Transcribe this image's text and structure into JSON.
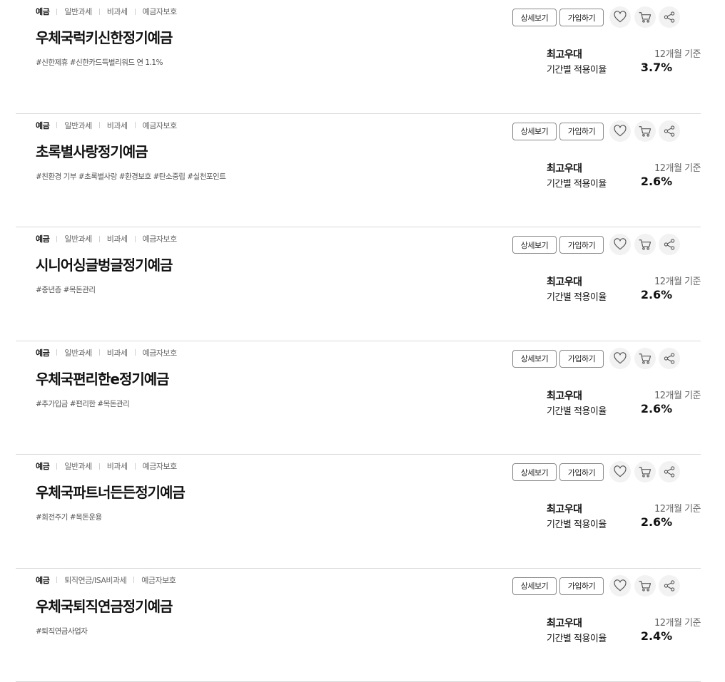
{
  "buttons": {
    "detail": "상세보기",
    "join": "가입하기"
  },
  "icons": {
    "favorite": "heart-icon",
    "cart": "cart-icon",
    "share": "share-icon"
  },
  "products": [
    {
      "cats": [
        "예금",
        "일반과세",
        "비과세",
        "예금자보호"
      ],
      "title": "우체국럭키신한정기예금",
      "tags": "#신한제휴 #신한카드득별리워드 연 1.1%",
      "rate_label1": "최고우대",
      "rate_label2": "기간별 적용이율",
      "basis": "12개월 기준",
      "rate": "3.7%"
    },
    {
      "cats": [
        "예금",
        "일반과세",
        "비과세",
        "예금자보호"
      ],
      "title": "초록별사랑정기예금",
      "tags": "#친환경 기부 #초록별사랑 #환경보호 #탄소중립 #실천포인트",
      "rate_label1": "최고우대",
      "rate_label2": "기간별 적용이율",
      "basis": "12개월 기준",
      "rate": "2.6%"
    },
    {
      "cats": [
        "예금",
        "일반과세",
        "비과세",
        "예금자보호"
      ],
      "title": "시니어싱글벙글정기예금",
      "tags": "#중년층 #목돈관리",
      "rate_label1": "최고우대",
      "rate_label2": "기간별 적용이율",
      "basis": "12개월 기준",
      "rate": "2.6%"
    },
    {
      "cats": [
        "예금",
        "일반과세",
        "비과세",
        "예금자보호"
      ],
      "title": "우체국편리한e정기예금",
      "tags": "#추가입금 #편리한 #목돈관리",
      "rate_label1": "최고우대",
      "rate_label2": "기간별 적용이율",
      "basis": "12개월 기준",
      "rate": "2.6%"
    },
    {
      "cats": [
        "예금",
        "일반과세",
        "비과세",
        "예금자보호"
      ],
      "title": "우체국파트너든든정기예금",
      "tags": "#회전주기 #목돈운용",
      "rate_label1": "최고우대",
      "rate_label2": "기간별 적용이율",
      "basis": "12개월 기준",
      "rate": "2.6%"
    },
    {
      "cats": [
        "예금",
        "퇴직연금/ISA비과세",
        "예금자보호"
      ],
      "title": "우체국퇴직연금정기예금",
      "tags": "#퇴직연금사업자",
      "rate_label1": "최고우대",
      "rate_label2": "기간별 적용이율",
      "basis": "12개월 기준",
      "rate": "2.4%"
    }
  ]
}
